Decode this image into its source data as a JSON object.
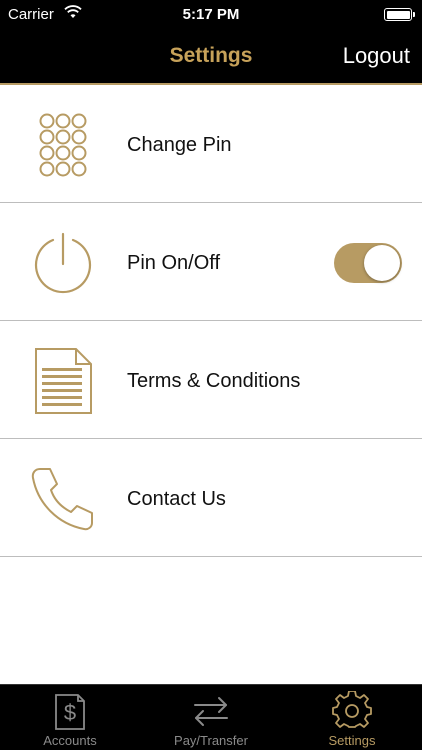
{
  "status_bar": {
    "carrier": "Carrier",
    "time": "5:17 PM"
  },
  "nav": {
    "title": "Settings",
    "logout_label": "Logout"
  },
  "colors": {
    "accent": "#b79b63",
    "title_gold": "#c7a25a",
    "bar_bg": "#000000",
    "divider": "#bdbdbd"
  },
  "settings": {
    "items": [
      {
        "label": "Change Pin",
        "icon": "keypad-icon"
      },
      {
        "label": "Pin On/Off",
        "icon": "power-icon",
        "toggle_on": true
      },
      {
        "label": "Terms & Conditions",
        "icon": "document-icon"
      },
      {
        "label": "Contact Us",
        "icon": "phone-icon"
      }
    ]
  },
  "tabs": [
    {
      "label": "Accounts",
      "icon": "dollar-document-icon",
      "active": false
    },
    {
      "label": "Pay/Transfer",
      "icon": "transfer-arrows-icon",
      "active": false
    },
    {
      "label": "Settings",
      "icon": "gear-icon",
      "active": true
    }
  ]
}
